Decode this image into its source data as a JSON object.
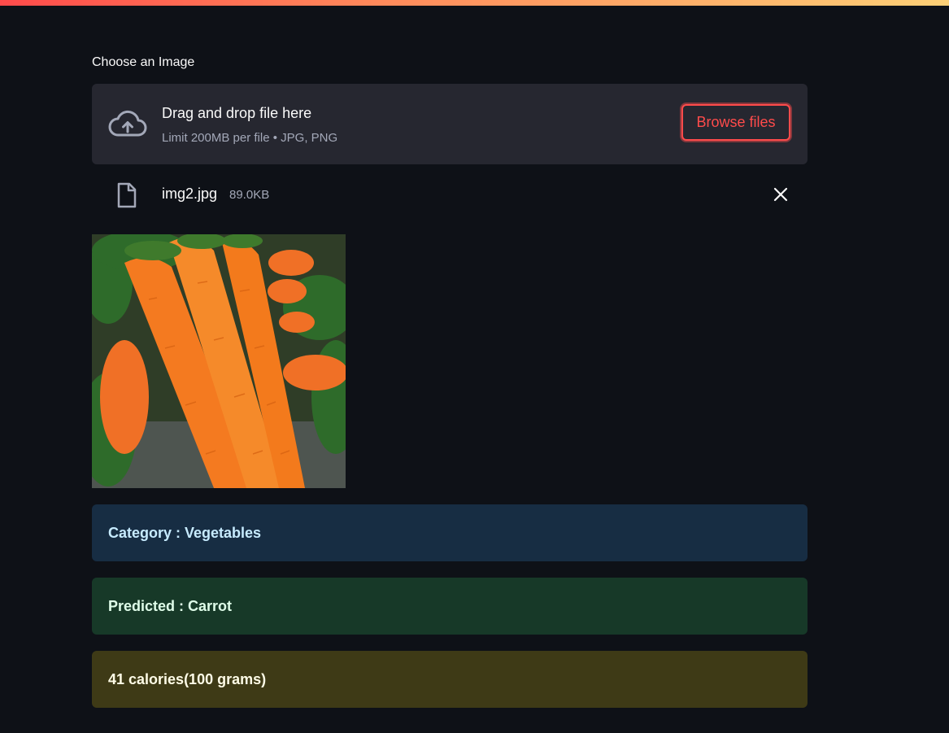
{
  "uploader": {
    "label": "Choose an Image",
    "dropzone_title": "Drag and drop file here",
    "dropzone_subtitle": "Limit 200MB per file • JPG, PNG",
    "browse_label": "Browse files"
  },
  "uploaded_file": {
    "name": "img2.jpg",
    "size": "89.0KB"
  },
  "preview": {
    "icon": "carrot-image",
    "alt": "Carrots"
  },
  "results": {
    "category": "Category : Vegetables",
    "predicted": "Predicted : Carrot",
    "calories": "41 calories(100 grams)"
  },
  "colors": {
    "accent": "#ff4b4b",
    "background": "#0e1117",
    "info_bg": "#172d43",
    "success_bg": "#173928",
    "warning_bg": "#3e3a16"
  }
}
